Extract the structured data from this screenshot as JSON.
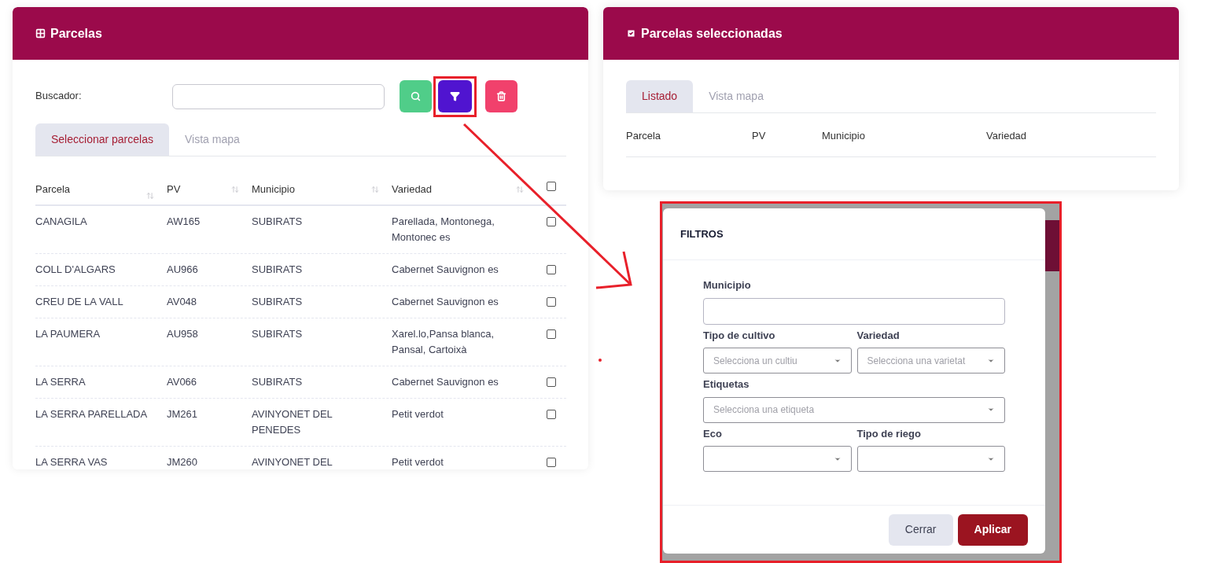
{
  "parcelas_panel": {
    "title": "Parcelas",
    "search": {
      "label": "Buscador:"
    },
    "tabs": [
      {
        "label": "Seleccionar parcelas",
        "selected": true
      },
      {
        "label": "Vista mapa",
        "selected": false
      }
    ],
    "table": {
      "columns": [
        {
          "label": "Parcela",
          "sortable": true
        },
        {
          "label": "PV",
          "sortable": true
        },
        {
          "label": "Municipio",
          "sortable": true
        },
        {
          "label": "Variedad",
          "sortable": true
        }
      ],
      "select_all": {
        "checked": false
      },
      "rows": [
        {
          "cells": [
            "CANAGILA",
            "AW165",
            "SUBIRATS",
            "Parellada, Montonega, Montonec es"
          ],
          "checked": false
        },
        {
          "cells": [
            "COLL D'ALGARS",
            "AU966",
            "SUBIRATS",
            "Cabernet Sauvignon es"
          ],
          "checked": false
        },
        {
          "cells": [
            "CREU DE LA VALL",
            "AV048",
            "SUBIRATS",
            "Cabernet Sauvignon es"
          ],
          "checked": false
        },
        {
          "cells": [
            "LA PAUMERA",
            "AU958",
            "SUBIRATS",
            "Xarel.lo,Pansa blanca, Pansal, Cartoixà"
          ],
          "checked": false
        },
        {
          "cells": [
            "LA SERRA",
            "AV066",
            "SUBIRATS",
            "Cabernet Sauvignon es"
          ],
          "checked": false
        },
        {
          "cells": [
            "LA SERRA PARELLADA",
            "JM261",
            "AVINYONET DEL PENEDES",
            "Petit verdot"
          ],
          "checked": false
        },
        {
          "cells": [
            "LA SERRA VAS",
            "JM260",
            "AVINYONET DEL",
            "Petit verdot"
          ],
          "checked": false
        }
      ]
    }
  },
  "selected_panel": {
    "title": "Parcelas seleccionadas",
    "tabs": [
      {
        "label": "Listado",
        "selected": true
      },
      {
        "label": "Vista mapa",
        "selected": false
      }
    ],
    "table": {
      "columns": [
        "Parcela",
        "PV",
        "Municipio",
        "Variedad"
      ]
    }
  },
  "filter_dialog": {
    "title": "FILTROS",
    "fields": [
      {
        "label": "Municipio",
        "kind": "text",
        "full_width": true
      },
      {
        "label": "Tipo de cultivo",
        "kind": "select",
        "full_width": false,
        "placeholder": "Selecciona un cultiu"
      },
      {
        "label": "Variedad",
        "kind": "select",
        "full_width": false,
        "placeholder": "Selecciona una varietat"
      },
      {
        "label": "Etiquetas",
        "kind": "select",
        "full_width": true,
        "placeholder": "Selecciona una etiqueta"
      },
      {
        "label": "Eco",
        "kind": "select",
        "full_width": false
      },
      {
        "label": "Tipo de riego",
        "kind": "select",
        "full_width": false
      }
    ],
    "buttons": [
      {
        "label": "Cerrar",
        "kind": "secondary"
      },
      {
        "label": "Aplicar",
        "kind": "primary"
      }
    ]
  }
}
